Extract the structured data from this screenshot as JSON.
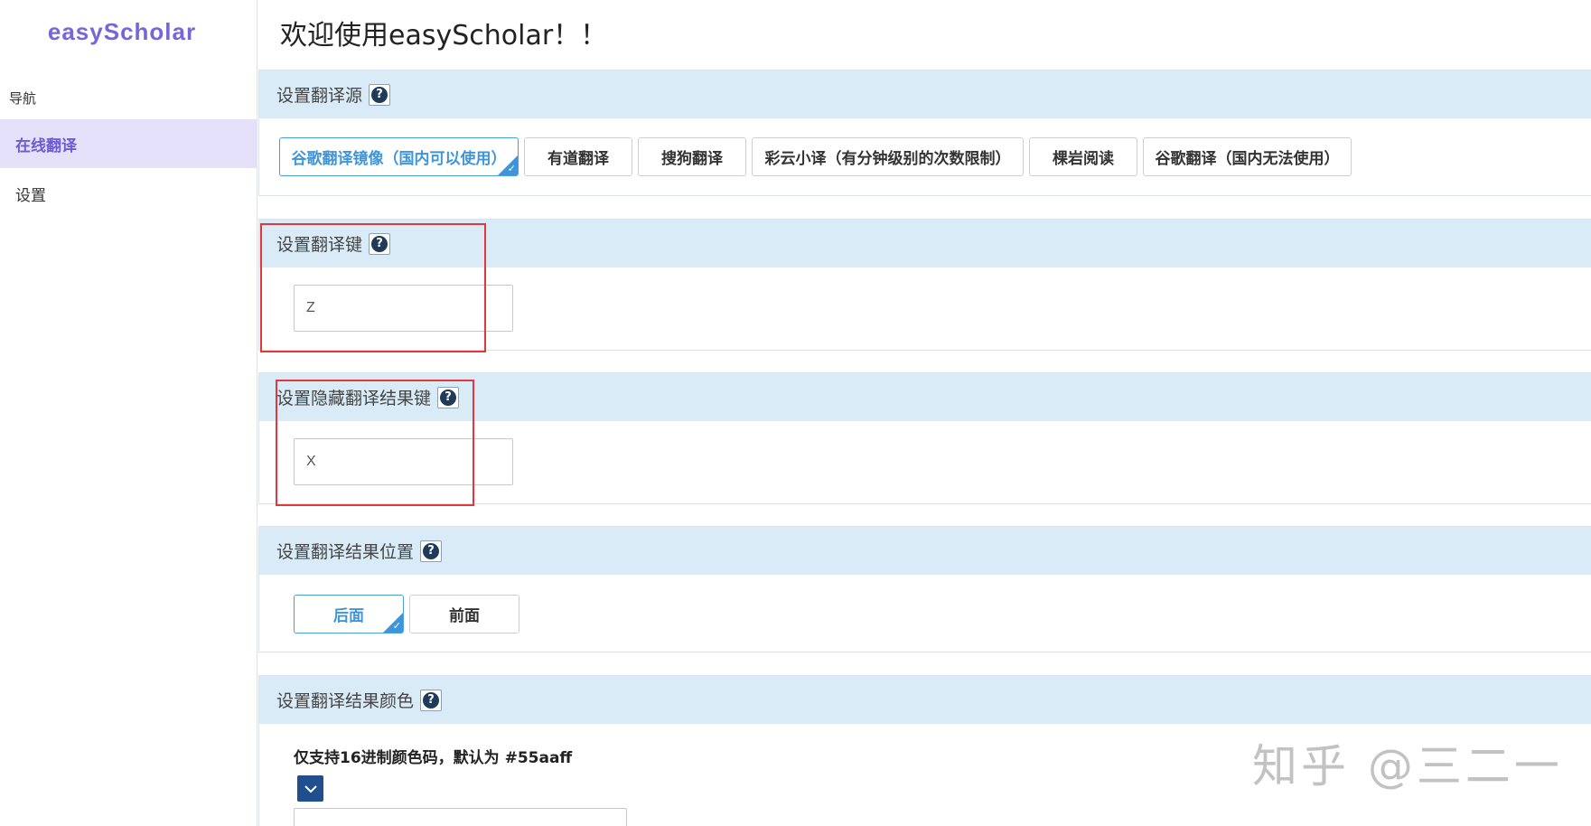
{
  "sidebar": {
    "brand": "easyScholar",
    "nav_heading": "导航",
    "items": [
      {
        "label": "在线翻译",
        "active": true
      },
      {
        "label": "设置",
        "active": false
      }
    ]
  },
  "main": {
    "title": "欢迎使用easyScholar！！",
    "translate_source": {
      "heading": "设置翻译源",
      "options": [
        {
          "label": "谷歌翻译镜像（国内可以使用）",
          "selected": true
        },
        {
          "label": "有道翻译",
          "selected": false
        },
        {
          "label": "搜狗翻译",
          "selected": false
        },
        {
          "label": "彩云小译（有分钟级别的次数限制）",
          "selected": false
        },
        {
          "label": "棵岩阅读",
          "selected": false
        },
        {
          "label": "谷歌翻译（国内无法使用）",
          "selected": false
        }
      ]
    },
    "translate_key": {
      "heading": "设置翻译键",
      "value": "Z"
    },
    "hide_key": {
      "heading": "设置隐藏翻译结果键",
      "value": "X"
    },
    "result_position": {
      "heading": "设置翻译结果位置",
      "options": [
        {
          "label": "后面",
          "selected": true
        },
        {
          "label": "前面",
          "selected": false
        }
      ]
    },
    "result_color": {
      "heading": "设置翻译结果颜色",
      "note": "仅支持16进制颜色码，默认为 #55aaff",
      "value": ""
    }
  },
  "colors": {
    "accent": "#3f95dc",
    "brand": "#7567d9",
    "panel_head": "#d9ebf7",
    "highlight_box": "#e0383b"
  },
  "watermark": "知乎 @三二一"
}
